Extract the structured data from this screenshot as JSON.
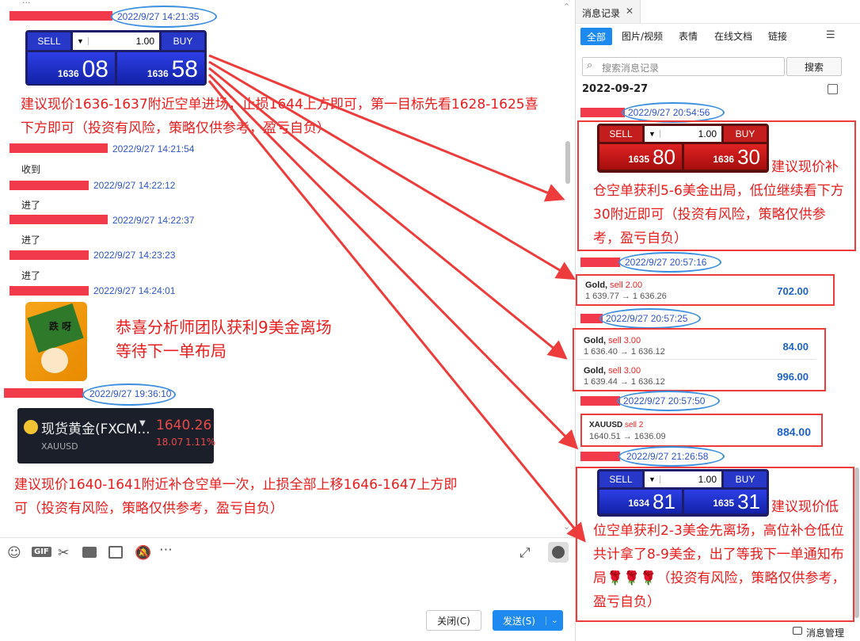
{
  "chat": {
    "messages": [
      {
        "ts": "2022/9/27 14:21:35"
      },
      {
        "ts": "2022/9/27 14:21:54",
        "text": "收到"
      },
      {
        "ts": "2022/9/27 14:22:12",
        "text": "进了"
      },
      {
        "ts": "2022/9/27 14:22:37",
        "text": "进了"
      },
      {
        "ts": "2022/9/27 14:23:23",
        "text": "进了"
      },
      {
        "ts": "2022/9/27 14:24:01"
      },
      {
        "ts": "2022/9/27 19:36:10"
      }
    ],
    "note1": "建议现价1636-1637附近空单进场，止损1644上方即可，第一目标先看1628-1625喜下方即可（投资有风险，策略仅供参考，盈亏自负）",
    "note2": "恭喜分析师团队获利9美金离场\n等待下一单布局",
    "note3": "建议现价1640-1641附近补仓空单一次，止损全部上移1646-1647上方即可（投资有风险，策略仅供参考，盈亏自负）",
    "sticker_text": "跌 呀",
    "quote": {
      "name": "现货黄金(FXCM...",
      "symbol": "XAUUSD",
      "price": "1640.26",
      "change": "18.07",
      "pct": "1.11%"
    },
    "trade1": {
      "sell": "SELL",
      "buy": "BUY",
      "qty": "1.00",
      "sell_small": "1636",
      "sell_big": "08",
      "buy_small": "1636",
      "buy_big": "58"
    }
  },
  "toolbar": {
    "close_label": "关闭(C)",
    "send_label": "发送(S)"
  },
  "history": {
    "tab_title": "消息记录",
    "filters": [
      "全部",
      "图片/视频",
      "表情",
      "在线文档",
      "链接"
    ],
    "search_placeholder": "搜索消息记录",
    "search_button": "搜索",
    "date": "2022-09-27",
    "ts1": "2022/9/27 20:54:56",
    "ts2": "2022/9/27 20:57:16",
    "ts3": "2022/9/27 20:57:25",
    "ts4": "2022/9/27 20:57:50",
    "ts5": "2022/9/27 21:26:58",
    "trade2": {
      "sell": "SELL",
      "buy": "BUY",
      "qty": "1.00",
      "sell_small": "1635",
      "sell_big": "80",
      "buy_small": "1636",
      "buy_big": "30"
    },
    "note4": "建议现价补仓空单获利5-6美金出局，低位继续看下方30附近即可（投资有风险，策略仅供参考，盈亏自负）",
    "order1": {
      "sym": "Gold,",
      "side": "sell 2.00",
      "path": "1 639.77 → 1 636.26",
      "amt": "702.00"
    },
    "order2": {
      "sym": "Gold,",
      "side": "sell 3.00",
      "path": "1 636.40 → 1 636.12",
      "amt": "84.00"
    },
    "order3": {
      "sym": "Gold,",
      "side": "sell 3.00",
      "path": "1 639.44 → 1 636.12",
      "amt": "996.00"
    },
    "order4": {
      "sym": "XAUUSD",
      "side": "sell 2",
      "path": "1640.51 → 1636.09",
      "amt": "884.00"
    },
    "trade3": {
      "sell": "SELL",
      "buy": "BUY",
      "qty": "1.00",
      "sell_small": "1634",
      "sell_big": "81",
      "buy_small": "1635",
      "buy_big": "31"
    },
    "note5": "建议现价低位空单获利2-3美金先离场，高位补仓低位共计拿了8-9美金，出了等我下一单通知布局🌹🌹🌹（投资有风险，策略仅供参考，盈亏自负）",
    "manage_label": "消息管理"
  },
  "colors": {
    "accent": "#1e8af0",
    "annotation_red": "#ee3b3b",
    "oval_blue": "#3c8fe0"
  }
}
